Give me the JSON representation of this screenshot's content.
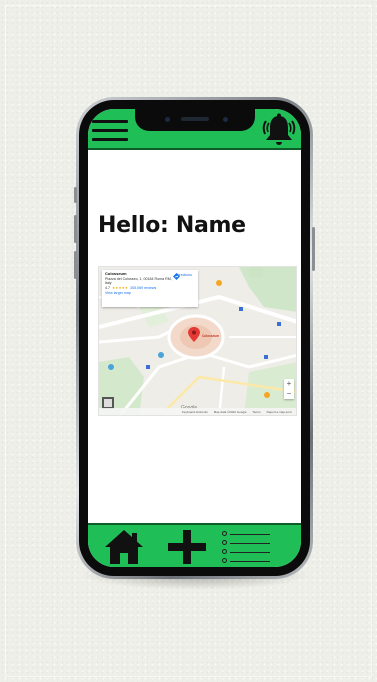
{
  "greeting": "Hello: Name",
  "map": {
    "place_name": "Colosseum",
    "address": "Piazza del Colosseo, 1, 00184 Roma RM, Italy",
    "rating": "4.7",
    "stars": "★★★★★",
    "reviews": "305,069 reviews",
    "view_larger": "View larger map",
    "directions": "Directions",
    "marker_label": "Colosseum",
    "google": "Google",
    "footer": [
      "Keyboard shortcuts",
      "Map data ©2022 Google",
      "Terms",
      "Report a map error"
    ],
    "zoom_in": "+",
    "zoom_out": "−"
  },
  "colors": {
    "accent": "#1fbe57",
    "accent_dark": "#0f5c2a",
    "icon": "#111111"
  },
  "icons": {
    "menu": "hamburger-menu-icon",
    "bell": "ringing-bell-icon",
    "home": "home-icon",
    "add": "plus-icon",
    "list": "list-icon"
  }
}
